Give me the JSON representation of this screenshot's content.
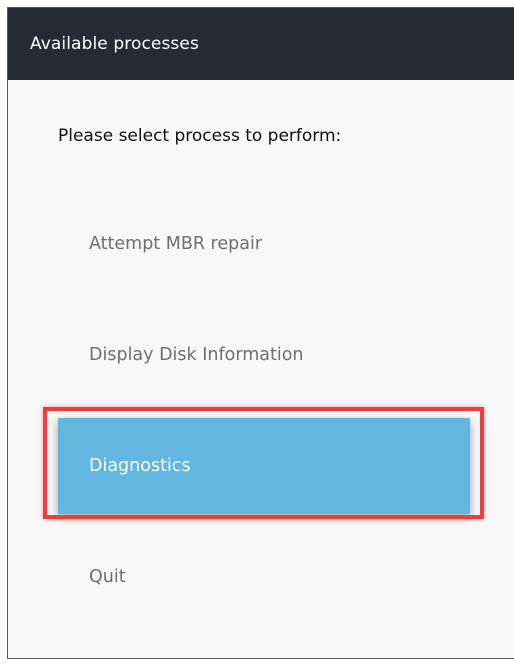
{
  "window": {
    "title": "Available processes"
  },
  "main": {
    "prompt": "Please select process to perform:",
    "items": [
      {
        "label": "Attempt MBR repair"
      },
      {
        "label": "Display Disk Information"
      },
      {
        "label": "Diagnostics",
        "selected": true
      },
      {
        "label": "Quit"
      }
    ]
  },
  "colors": {
    "titlebar": "#252a33",
    "selected_item": "#63b6e0",
    "highlight_frame": "#e8403e"
  }
}
